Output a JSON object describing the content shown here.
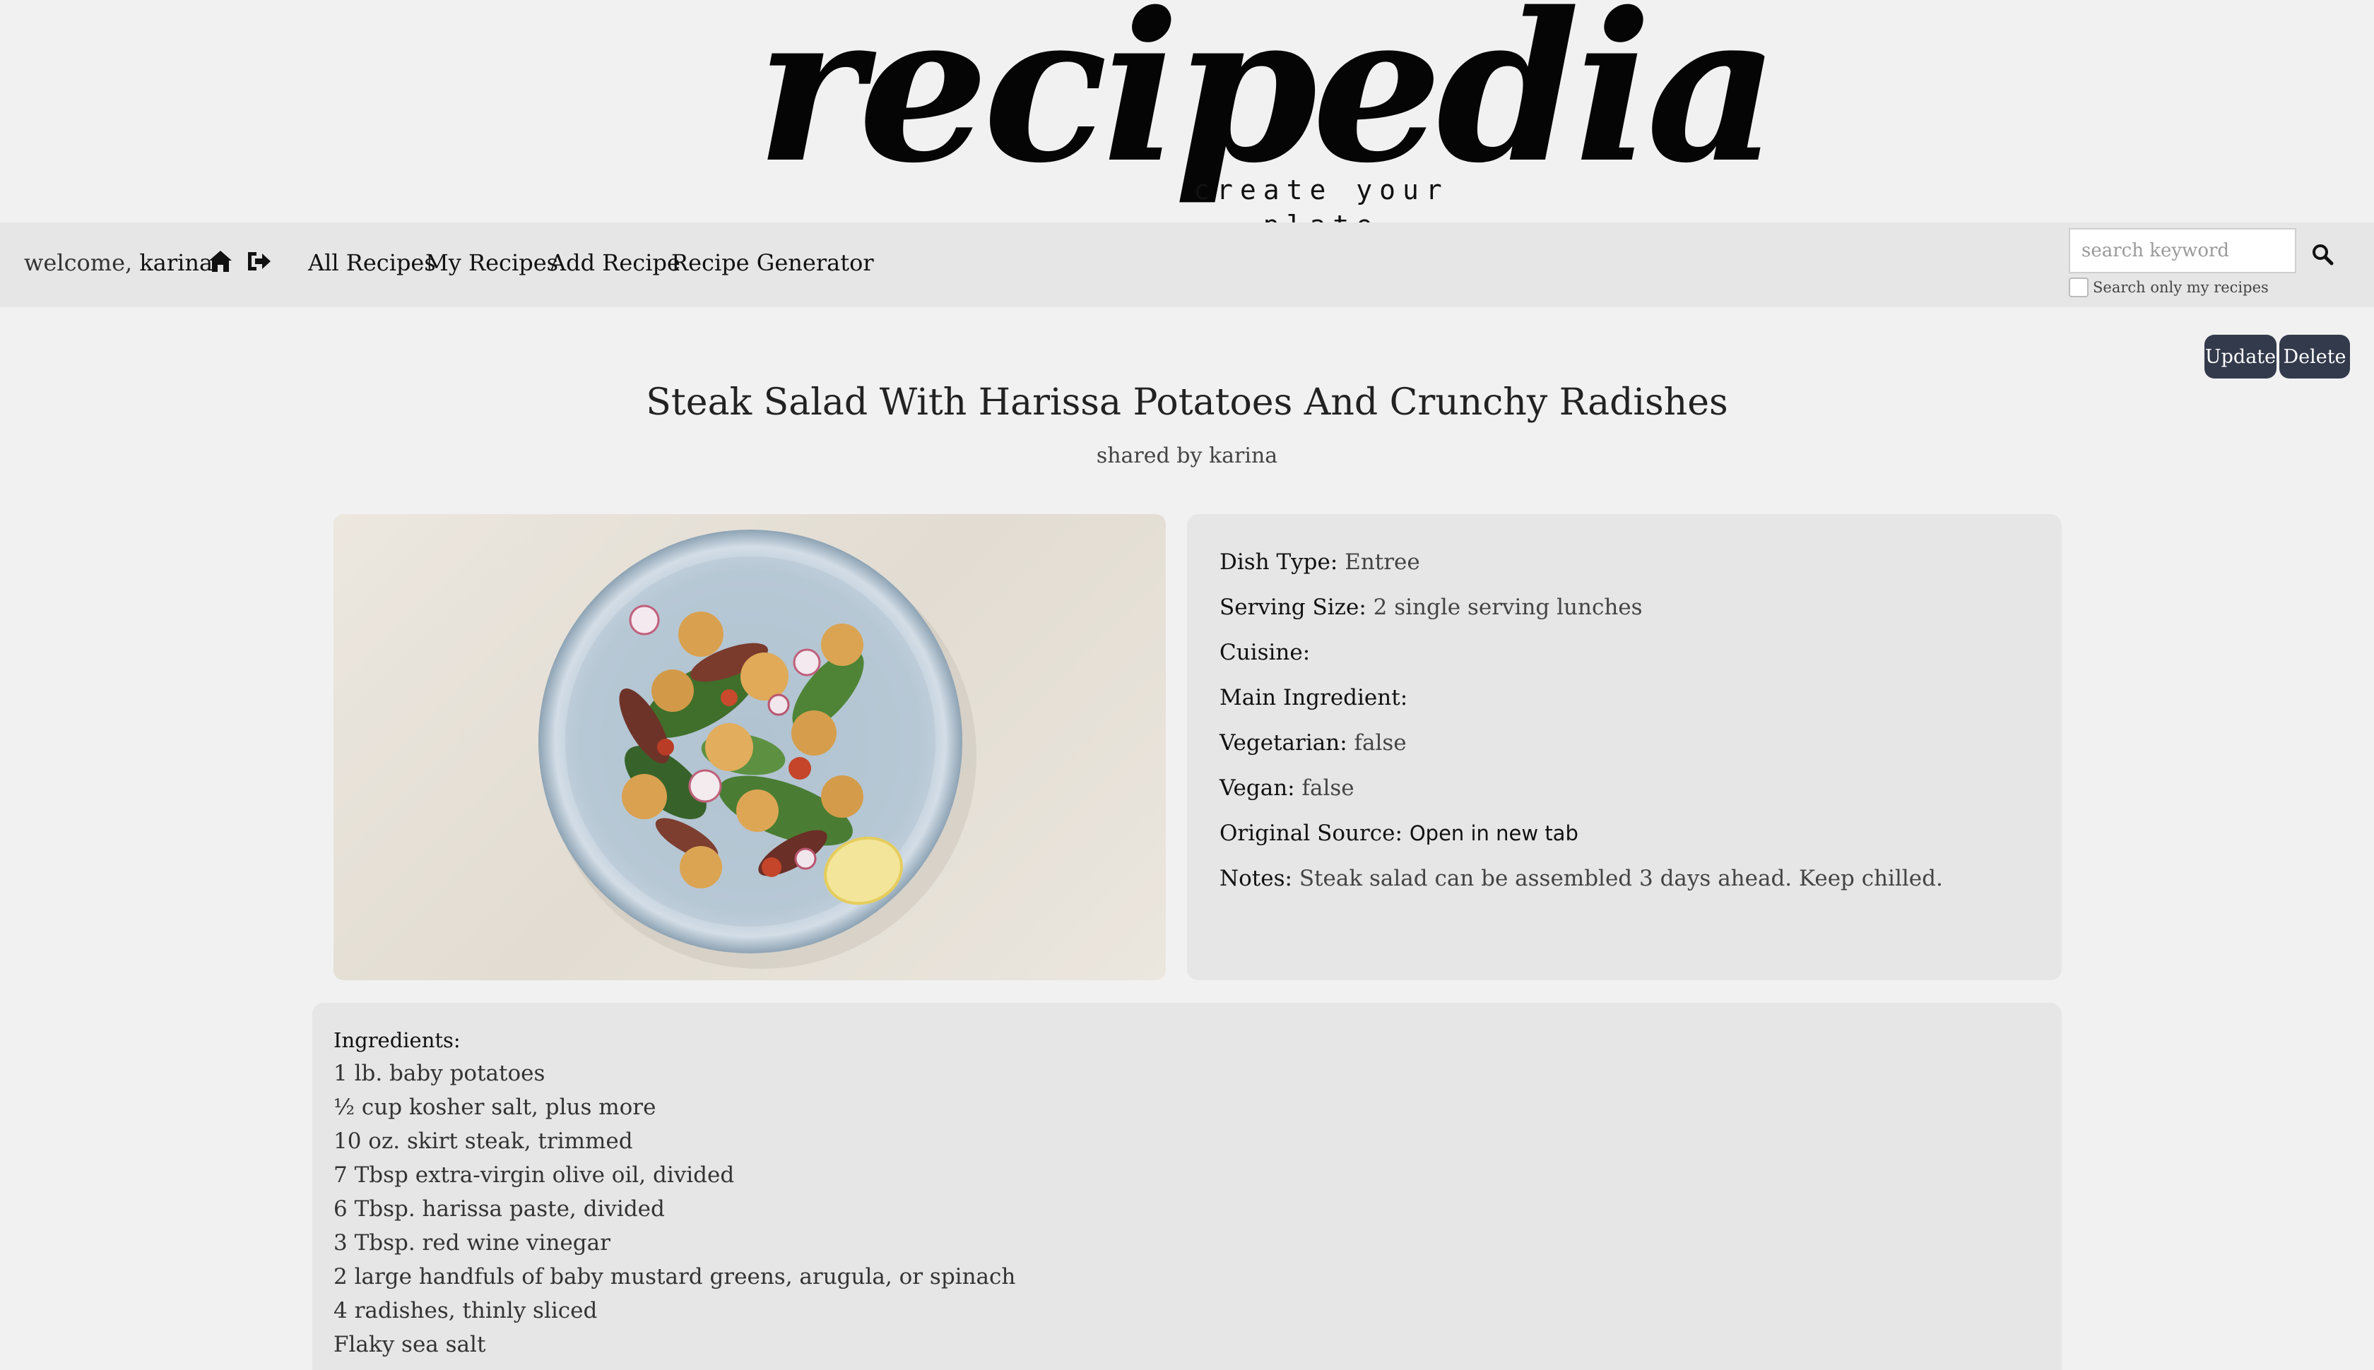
{
  "header": {
    "logo": "recipedia",
    "tagline": "create your plate"
  },
  "nav": {
    "welcome_prefix": "welcome,",
    "username": "karina",
    "links": [
      "All Recipes",
      "My Recipes",
      "Add Recipe",
      "Recipe Generator"
    ],
    "search_placeholder": "search keyword",
    "search_only_mine_label": "Search only my recipes"
  },
  "actions": {
    "update": "Update",
    "delete": "Delete"
  },
  "recipe": {
    "title": "Steak Salad With Harissa Potatoes And Crunchy Radishes",
    "shared_by": "shared by karina",
    "details": [
      {
        "label": "Dish Type:",
        "value": "Entree"
      },
      {
        "label": "Serving Size:",
        "value": "2 single serving lunches"
      },
      {
        "label": "Cuisine:",
        "value": ""
      },
      {
        "label": "Main Ingredient:",
        "value": ""
      },
      {
        "label": "Vegetarian:",
        "value": "false"
      },
      {
        "label": "Vegan:",
        "value": "false"
      },
      {
        "label": "Original Source:",
        "value": "Open in new tab"
      },
      {
        "label": "Notes:",
        "value": "Steak salad can be assembled 3 days ahead. Keep chilled."
      }
    ],
    "ingredients_title": "Ingredients:",
    "ingredients": [
      "1 lb. baby potatoes",
      "½ cup kosher salt, plus more",
      "10 oz. skirt steak, trimmed",
      "7 Tbsp extra-virgin olive oil, divided",
      "6 Tbsp. harissa paste, divided",
      "3 Tbsp. red wine vinegar",
      "2 large handfuls of baby mustard greens, arugula, or spinach",
      "4 radishes, thinly sliced",
      "Flaky sea salt"
    ]
  },
  "colors": {
    "page_bg": "#f1f1f1",
    "nav_bg": "#e6e6e6",
    "button_bg": "#323a4b"
  }
}
